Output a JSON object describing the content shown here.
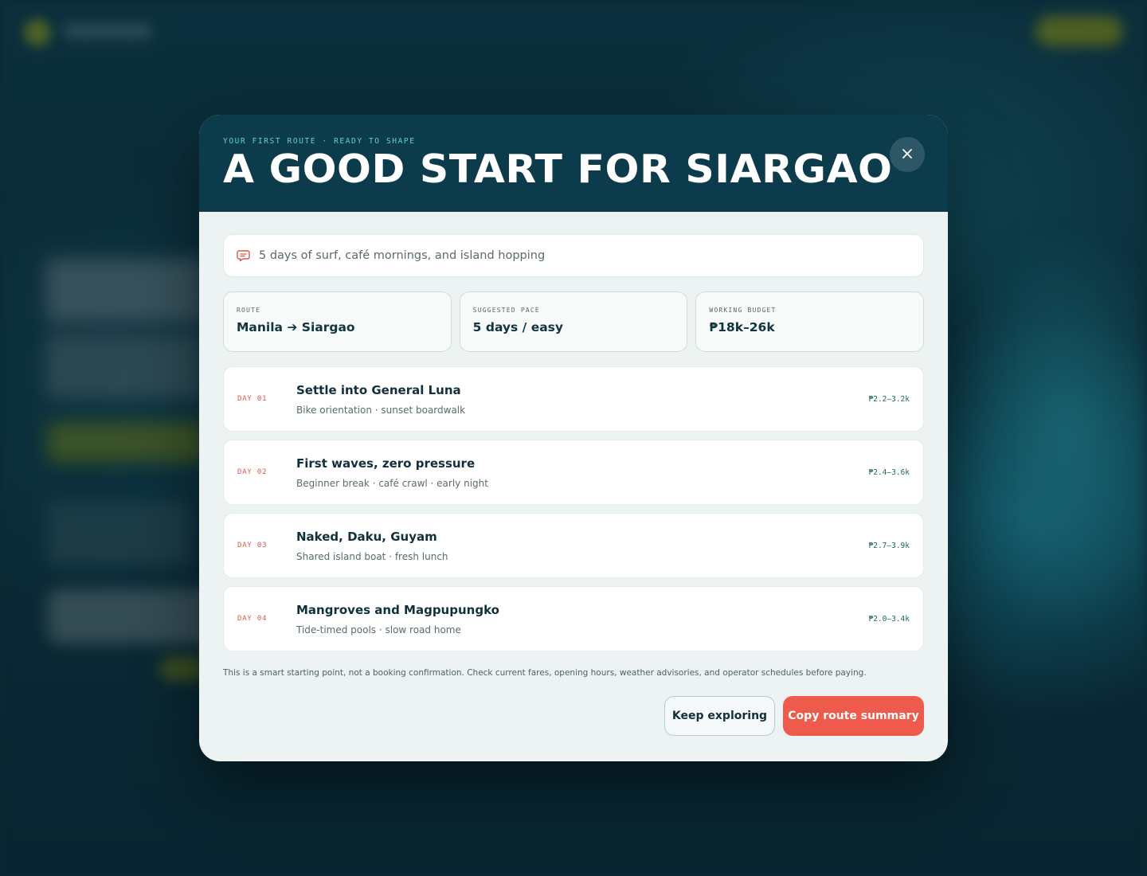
{
  "modal": {
    "eyebrow": "YOUR FIRST ROUTE · READY TO SHAPE",
    "title": "A GOOD START FOR SIARGAO",
    "close_icon": "close-icon",
    "prompt": {
      "icon": "chat-bubble-icon",
      "text": "5 days of surf, café mornings, and island hopping"
    },
    "stats": [
      {
        "label": "ROUTE",
        "value": "Manila ➔ Siargao"
      },
      {
        "label": "SUGGESTED PACE",
        "value": "5 days / easy"
      },
      {
        "label": "WORKING BUDGET",
        "value": "₱18k–26k"
      }
    ],
    "days": [
      {
        "tag": "DAY 01",
        "title": "Settle into General Luna",
        "subtitle": "Bike orientation · sunset boardwalk",
        "price": "₱2.2–3.2k"
      },
      {
        "tag": "DAY 02",
        "title": "First waves, zero pressure",
        "subtitle": "Beginner break · café crawl · early night",
        "price": "₱2.4–3.6k"
      },
      {
        "tag": "DAY 03",
        "title": "Naked, Daku, Guyam",
        "subtitle": "Shared island boat · fresh lunch",
        "price": "₱2.7–3.9k"
      },
      {
        "tag": "DAY 04",
        "title": "Mangroves and Magpupungko",
        "subtitle": "Tide-timed pools · slow road home",
        "price": "₱2.0–3.4k"
      }
    ],
    "disclaimer": "This is a smart starting point, not a booking confirmation. Check current fares, opening hours, weather advisories, and operator schedules before paying.",
    "buttons": {
      "secondary": "Keep exploring",
      "primary": "Copy route summary"
    }
  },
  "colors": {
    "header_bg": "#0c3c4b",
    "accent_teal": "#5fd3c8",
    "accent_coral": "#ee5a4c",
    "price_green": "#1d6b58",
    "modal_bg": "#ecf3f2"
  }
}
